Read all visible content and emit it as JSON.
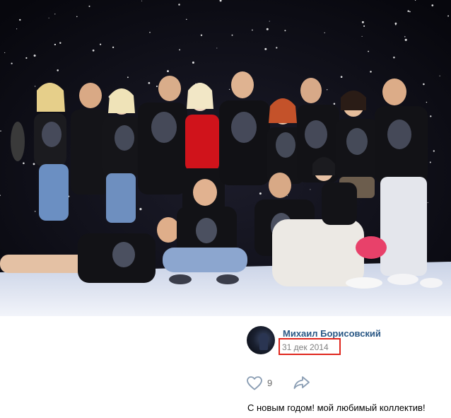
{
  "post": {
    "author": "Михаил Борисовский",
    "date": "31 дек 2014",
    "likes": "9",
    "caption": "С новым годом! мой любимый коллектив!"
  },
  "icons": {
    "avatar": "author-avatar",
    "like": "heart-icon",
    "share": "share-arrow-icon"
  },
  "colors": {
    "author_link": "#2a5885",
    "date_text": "#828282",
    "highlight_box": "#e0261d",
    "icon": "#8a9db3"
  }
}
